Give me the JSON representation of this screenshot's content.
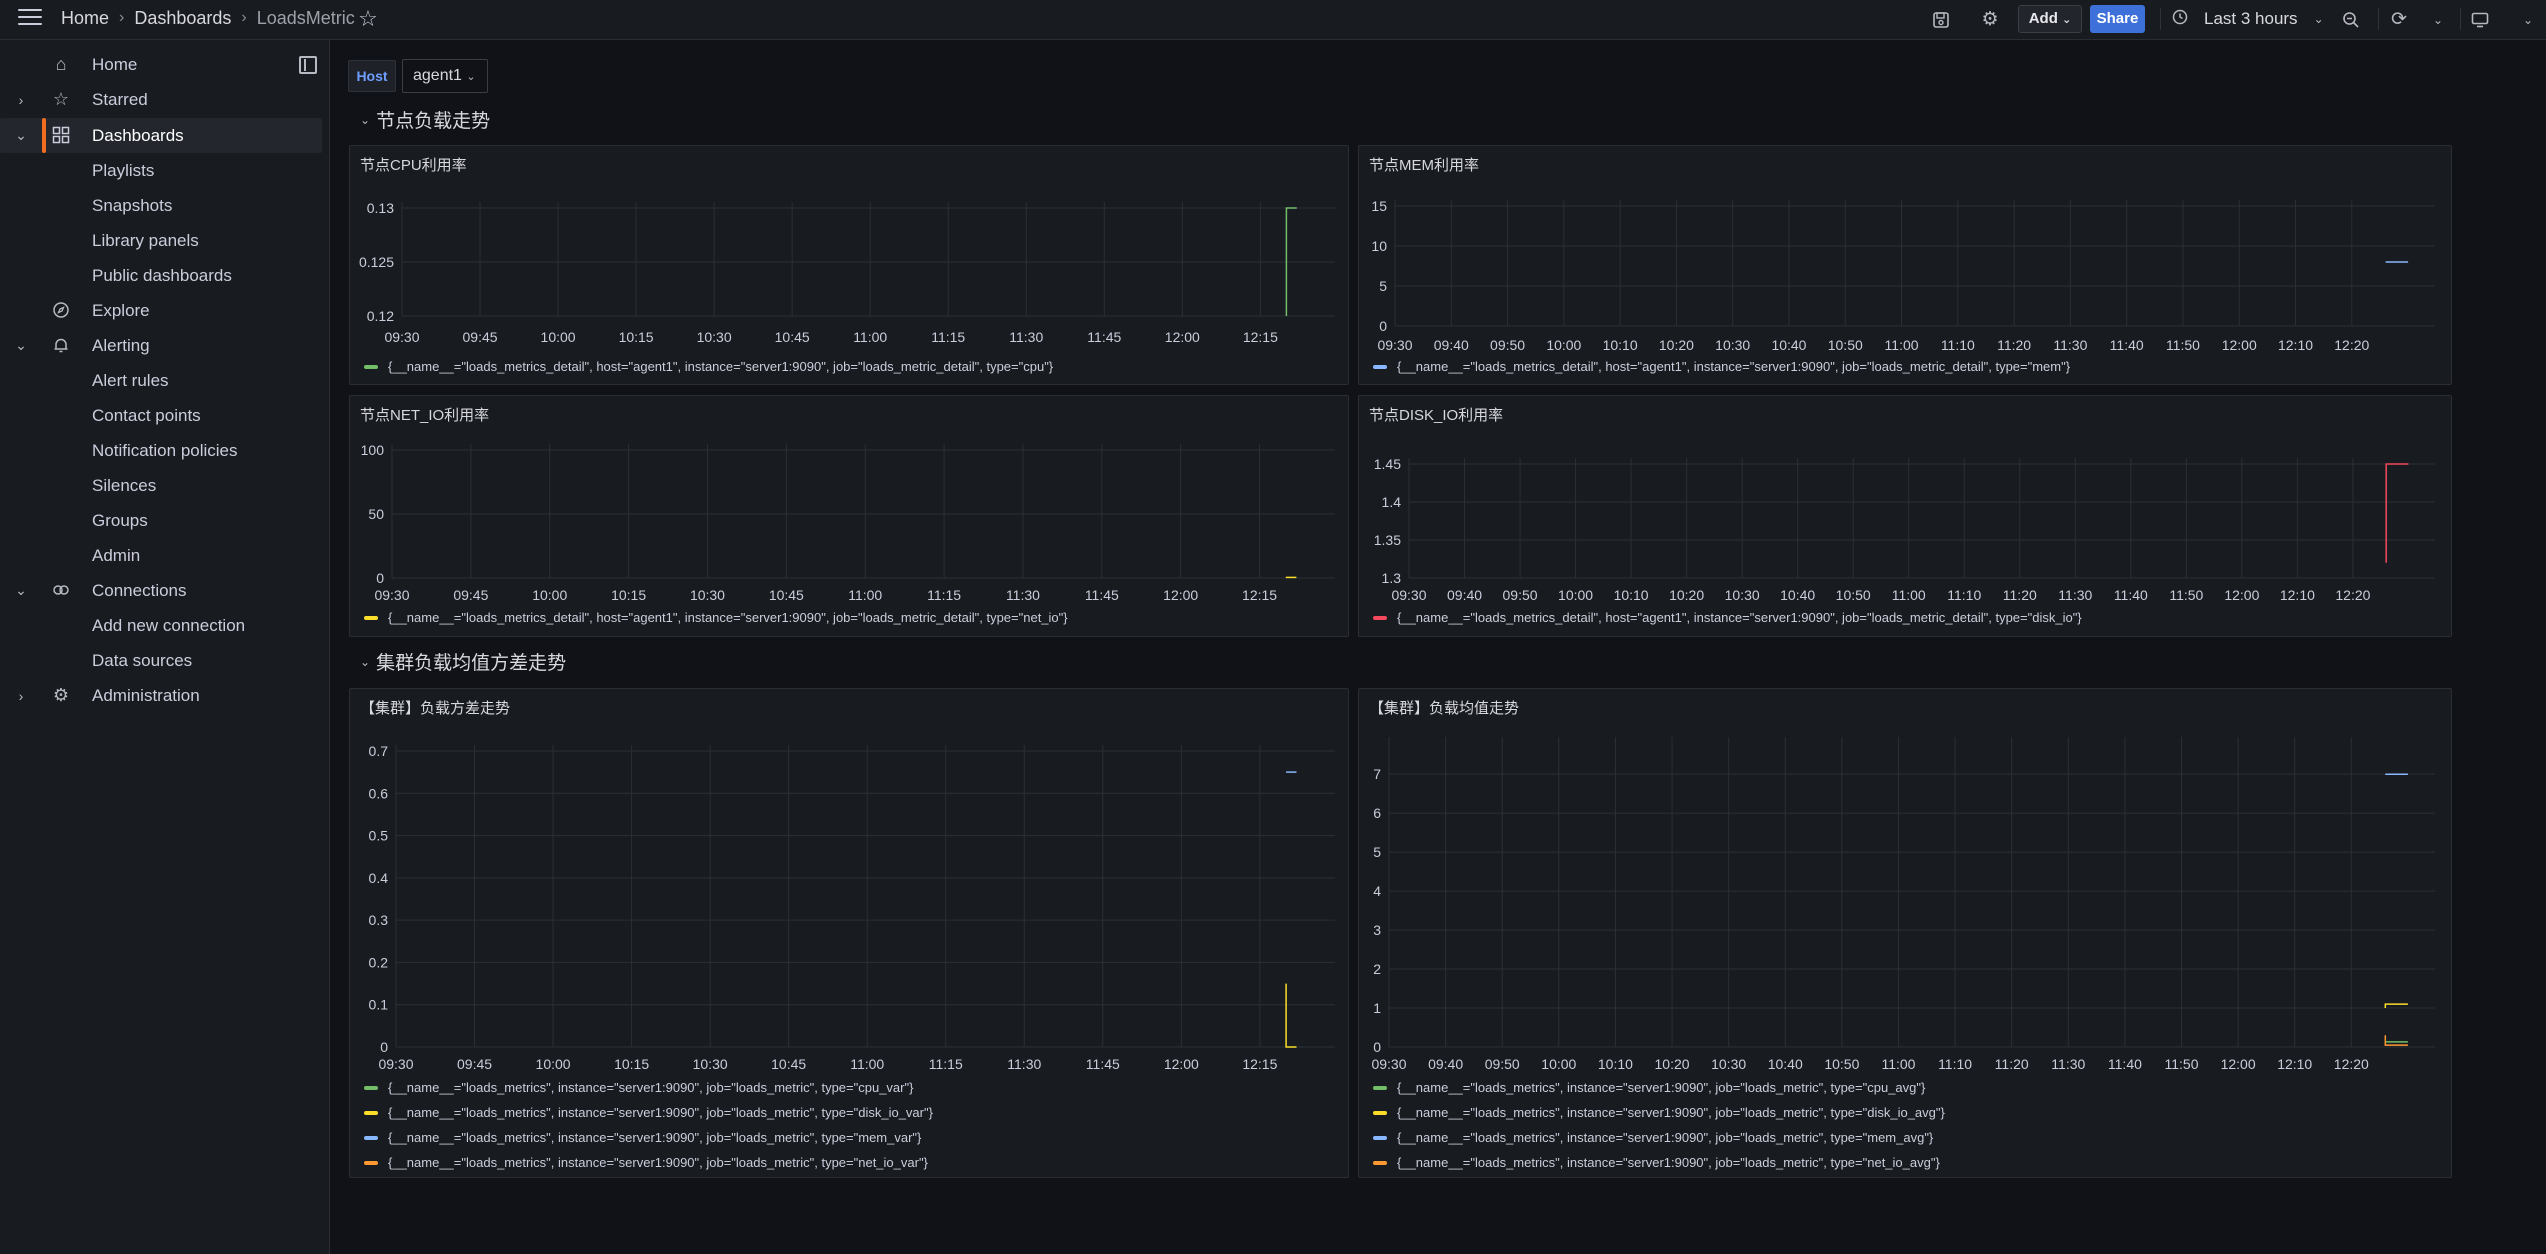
{
  "topbar": {
    "breadcrumbs": [
      "Home",
      "Dashboards",
      "LoadsMetric"
    ],
    "add_label": "Add",
    "share_label": "Share",
    "time_range": "Last 3 hours",
    "icons": [
      "menu-icon",
      "star-icon",
      "save-icon",
      "gear-icon",
      "clock-icon",
      "zoom-out-icon",
      "refresh-icon",
      "tv-mode-icon"
    ]
  },
  "sidebar": {
    "items": [
      {
        "label": "Home",
        "icon": "home-icon"
      },
      {
        "label": "Starred",
        "icon": "star-icon"
      },
      {
        "label": "Dashboards",
        "icon": "apps-icon"
      },
      {
        "label": "Playlists"
      },
      {
        "label": "Snapshots"
      },
      {
        "label": "Library panels"
      },
      {
        "label": "Public dashboards"
      },
      {
        "label": "Explore",
        "icon": "compass-icon"
      },
      {
        "label": "Alerting",
        "icon": "bell-icon"
      },
      {
        "label": "Alert rules"
      },
      {
        "label": "Contact points"
      },
      {
        "label": "Notification policies"
      },
      {
        "label": "Silences"
      },
      {
        "label": "Groups"
      },
      {
        "label": "Admin"
      },
      {
        "label": "Connections",
        "icon": "connections-icon"
      },
      {
        "label": "Add new connection"
      },
      {
        "label": "Data sources"
      },
      {
        "label": "Administration",
        "icon": "cog-icon"
      }
    ]
  },
  "variables": {
    "host_label": "Host",
    "host_value": "agent1"
  },
  "rows": [
    {
      "title": "节点负载走势"
    },
    {
      "title": "集群负载均值方差走势"
    }
  ],
  "colors": {
    "green": "#73bf69",
    "yellow": "#fade2a",
    "blue": "#8ab8ff",
    "orange": "#ff9830",
    "red": "#f2495c"
  },
  "chart_data": [
    {
      "type": "line",
      "title": "节点CPU利用率",
      "x_ticks": [
        "09:30",
        "09:45",
        "10:00",
        "10:15",
        "10:30",
        "10:45",
        "11:00",
        "11:15",
        "11:30",
        "11:45",
        "12:00",
        "12:15"
      ],
      "y_ticks": [
        "0.12",
        "0.125",
        "0.13"
      ],
      "ylim": [
        0.12,
        0.13
      ],
      "series": [
        {
          "name": "{__name__=\"loads_metrics_detail\", host=\"agent1\", instance=\"server1:9090\", job=\"loads_metric_detail\", type=\"cpu\"}",
          "color": "#73bf69",
          "x": [
            "12:20",
            "12:20",
            "12:22"
          ],
          "values": [
            0.12,
            0.13,
            0.13
          ]
        }
      ]
    },
    {
      "type": "line",
      "title": "节点MEM利用率",
      "x_ticks": [
        "09:30",
        "09:40",
        "09:50",
        "10:00",
        "10:10",
        "10:20",
        "10:30",
        "10:40",
        "10:50",
        "11:00",
        "11:10",
        "11:20",
        "11:30",
        "11:40",
        "11:50",
        "12:00",
        "12:10",
        "12:20"
      ],
      "y_ticks": [
        "0",
        "5",
        "10",
        "15"
      ],
      "ylim": [
        0,
        15
      ],
      "series": [
        {
          "name": "{__name__=\"loads_metrics_detail\", host=\"agent1\", instance=\"server1:9090\", job=\"loads_metric_detail\", type=\"mem\"}",
          "color": "#8ab8ff",
          "x": [
            "12:26",
            "12:30"
          ],
          "values": [
            8,
            8
          ]
        }
      ]
    },
    {
      "type": "line",
      "title": "节点NET_IO利用率",
      "x_ticks": [
        "09:30",
        "09:45",
        "10:00",
        "10:15",
        "10:30",
        "10:45",
        "11:00",
        "11:15",
        "11:30",
        "11:45",
        "12:00",
        "12:15"
      ],
      "y_ticks": [
        "0",
        "50",
        "100"
      ],
      "ylim": [
        0,
        100
      ],
      "series": [
        {
          "name": "{__name__=\"loads_metrics_detail\", host=\"agent1\", instance=\"server1:9090\", job=\"loads_metric_detail\", type=\"net_io\"}",
          "color": "#fade2a",
          "x": [
            "12:20",
            "12:22"
          ],
          "values": [
            0.5,
            0.5
          ]
        }
      ]
    },
    {
      "type": "line",
      "title": "节点DISK_IO利用率",
      "x_ticks": [
        "09:30",
        "09:40",
        "09:50",
        "10:00",
        "10:10",
        "10:20",
        "10:30",
        "10:40",
        "10:50",
        "11:00",
        "11:10",
        "11:20",
        "11:30",
        "11:40",
        "11:50",
        "12:00",
        "12:10",
        "12:20"
      ],
      "y_ticks": [
        "1.3",
        "1.35",
        "1.4",
        "1.45"
      ],
      "ylim": [
        1.3,
        1.45
      ],
      "series": [
        {
          "name": "{__name__=\"loads_metrics_detail\", host=\"agent1\", instance=\"server1:9090\", job=\"loads_metric_detail\", type=\"disk_io\"}",
          "color": "#f2495c",
          "x": [
            "12:26",
            "12:26",
            "12:30"
          ],
          "values": [
            1.32,
            1.45,
            1.45
          ]
        }
      ]
    },
    {
      "type": "line",
      "title": "【集群】负载方差走势",
      "x_ticks": [
        "09:30",
        "09:45",
        "10:00",
        "10:15",
        "10:30",
        "10:45",
        "11:00",
        "11:15",
        "11:30",
        "11:45",
        "12:00",
        "12:15"
      ],
      "y_ticks": [
        "0",
        "0.1",
        "0.2",
        "0.3",
        "0.4",
        "0.5",
        "0.6",
        "0.7"
      ],
      "ylim": [
        0,
        0.7
      ],
      "series": [
        {
          "name": "{__name__=\"loads_metrics\", instance=\"server1:9090\", job=\"loads_metric\", type=\"cpu_var\"}",
          "color": "#73bf69",
          "x": [],
          "values": []
        },
        {
          "name": "{__name__=\"loads_metrics\", instance=\"server1:9090\", job=\"loads_metric\", type=\"disk_io_var\"}",
          "color": "#fade2a",
          "x": [
            "12:20",
            "12:20",
            "12:22"
          ],
          "values": [
            0.15,
            0,
            0
          ]
        },
        {
          "name": "{__name__=\"loads_metrics\", instance=\"server1:9090\", job=\"loads_metric\", type=\"mem_var\"}",
          "color": "#8ab8ff",
          "x": [
            "12:20",
            "12:22"
          ],
          "values": [
            0.65,
            0.65
          ]
        },
        {
          "name": "{__name__=\"loads_metrics\", instance=\"server1:9090\", job=\"loads_metric\", type=\"net_io_var\"}",
          "color": "#ff9830",
          "x": [],
          "values": []
        }
      ]
    },
    {
      "type": "line",
      "title": "【集群】负载均值走势",
      "x_ticks": [
        "09:30",
        "09:40",
        "09:50",
        "10:00",
        "10:10",
        "10:20",
        "10:30",
        "10:40",
        "10:50",
        "11:00",
        "11:10",
        "11:20",
        "11:30",
        "11:40",
        "11:50",
        "12:00",
        "12:10",
        "12:20"
      ],
      "y_ticks": [
        "0",
        "1",
        "2",
        "3",
        "4",
        "5",
        "6",
        "7"
      ],
      "ylim": [
        0,
        7.8
      ],
      "series": [
        {
          "name": "{__name__=\"loads_metrics\", instance=\"server1:9090\", job=\"loads_metric\", type=\"cpu_avg\"}",
          "color": "#73bf69",
          "x": [
            "12:26",
            "12:30"
          ],
          "values": [
            0.13,
            0.13
          ]
        },
        {
          "name": "{__name__=\"loads_metrics\", instance=\"server1:9090\", job=\"loads_metric\", type=\"disk_io_avg\"}",
          "color": "#fade2a",
          "x": [
            "12:26",
            "12:26",
            "12:30"
          ],
          "values": [
            1.0,
            1.1,
            1.1
          ]
        },
        {
          "name": "{__name__=\"loads_metrics\", instance=\"server1:9090\", job=\"loads_metric\", type=\"mem_avg\"}",
          "color": "#8ab8ff",
          "x": [
            "12:26",
            "12:30"
          ],
          "values": [
            7.0,
            7.0
          ]
        },
        {
          "name": "{__name__=\"loads_metrics\", instance=\"server1:9090\", job=\"loads_metric\", type=\"net_io_avg\"}",
          "color": "#ff9830",
          "x": [
            "12:26",
            "12:26",
            "12:30"
          ],
          "values": [
            0.3,
            0.05,
            0.05
          ]
        }
      ]
    }
  ]
}
